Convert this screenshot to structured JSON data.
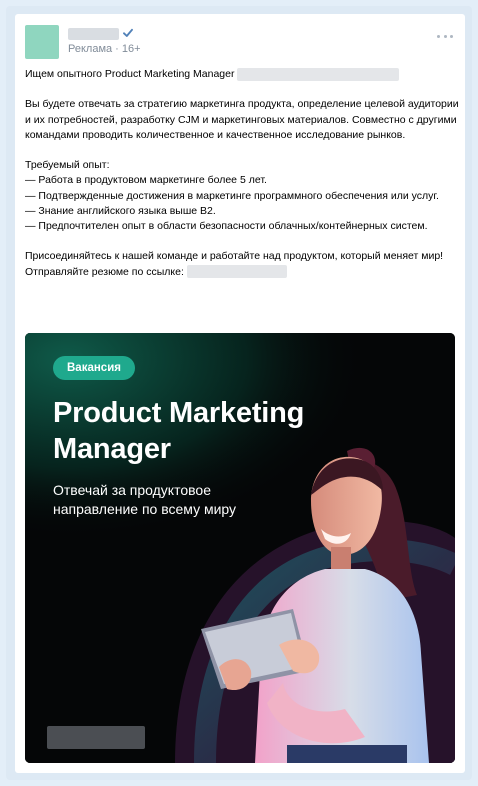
{
  "post": {
    "author_label": "Реклама · 16+",
    "headline": "Ищем опытного Product Marketing Manager",
    "paragraph1": "Вы будете отвечать за стратегию маркетинга продукта, определение целевой аудитории и их потребностей, разработку CJM и маркетинговых материалов. Совместно с другими командами проводить количественное и качественное исследование рынков.",
    "req_title": "Требуемый опыт:",
    "requirements": [
      "— Работа в продуктовом маркетинге более 5 лет.",
      "— Подтвержденные достижения в маркетинге программного обеспечения или услуг.",
      "— Знание английского языка выше B2.",
      "— Предпочтителен опыт в области безопасности облачных/контейнерных систем."
    ],
    "cta": "Присоединяйтесь к нашей команде и работайте над продуктом, который меняет мир! Отправляйте резюме по ссылке:"
  },
  "banner": {
    "badge": "Вакансия",
    "title": "Product Marketing Manager",
    "subtitle": "Отвечай за продуктовое направление по всему миру"
  },
  "colors": {
    "accent": "#1fa98d",
    "verified": "#5181b8",
    "avatar": "#8fd6bf"
  }
}
